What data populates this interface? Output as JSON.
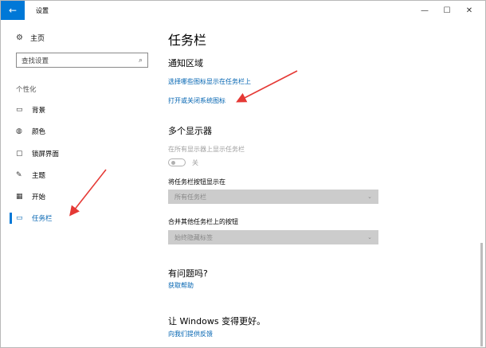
{
  "window": {
    "title": "设置",
    "back_glyph": "←",
    "minimize_glyph": "—",
    "maximize_glyph": "☐",
    "close_glyph": "✕"
  },
  "sidebar": {
    "home": {
      "label": "主页",
      "icon": "gear-icon"
    },
    "search": {
      "placeholder": "查找设置",
      "icon": "search-icon"
    },
    "section_label": "个性化",
    "items": [
      {
        "label": "背景",
        "icon": "image-icon",
        "active": false
      },
      {
        "label": "颜色",
        "icon": "palette-icon",
        "active": false
      },
      {
        "label": "锁屏界面",
        "icon": "lock-screen-icon",
        "active": false
      },
      {
        "label": "主题",
        "icon": "theme-brush-icon",
        "active": false
      },
      {
        "label": "开始",
        "icon": "start-menu-icon",
        "active": false
      },
      {
        "label": "任务栏",
        "icon": "taskbar-icon",
        "active": true
      }
    ]
  },
  "main": {
    "title": "任务栏",
    "notification_area": {
      "heading": "通知区域",
      "link1": "选择哪些图标显示在任务栏上",
      "link2": "打开或关闭系统图标"
    },
    "multiple_displays": {
      "heading": "多个显示器",
      "show_on_all_label": "在所有显示器上显示任务栏",
      "toggle_state": "关",
      "buttons_on_label": "将任务栏按钮显示在",
      "buttons_on_value": "所有任务栏",
      "combine_label": "合并其他任务栏上的按钮",
      "combine_value": "始终隐藏标签"
    },
    "questions": {
      "heading": "有问题吗?",
      "link": "获取帮助"
    },
    "feedback": {
      "heading": "让 Windows 变得更好。",
      "link": "向我们提供反馈"
    }
  },
  "colors": {
    "accent": "#0078d7",
    "link": "#0063b1",
    "arrow": "#e53935",
    "disabled_select": "#cccccc"
  }
}
